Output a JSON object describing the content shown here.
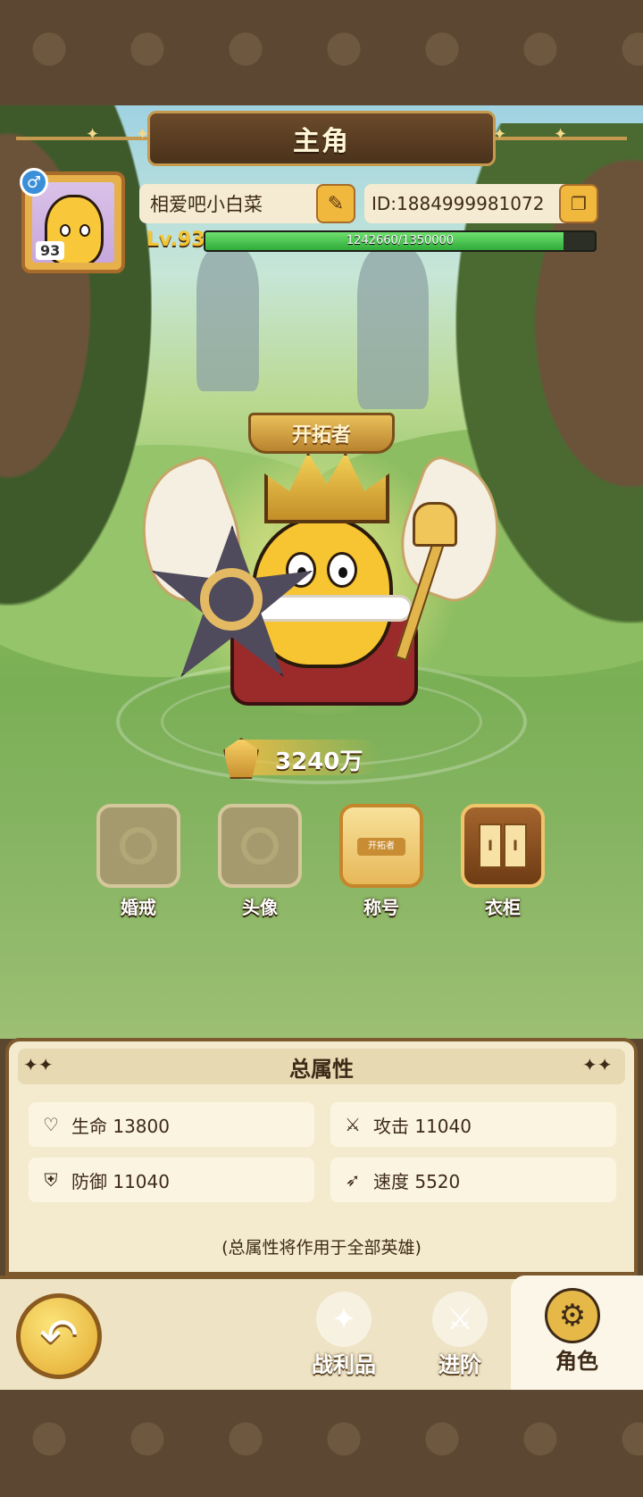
{
  "header": {
    "title": "主角"
  },
  "profile": {
    "gender_symbol": "♂",
    "avatar_level": "93",
    "name": "相爱吧小白菜",
    "id_text": "ID:1884999981072",
    "level_text": "Lv.93",
    "exp_text": "1242660/1350000",
    "exp_fraction": 0.92
  },
  "character": {
    "title_badge": "开拓者",
    "power": "3240万"
  },
  "functions": [
    {
      "label": "婚戒",
      "state": "locked",
      "icon": "ring-icon"
    },
    {
      "label": "头像",
      "state": "locked",
      "icon": "ring-icon"
    },
    {
      "label": "称号",
      "state": "active",
      "icon": "title-plaque-icon",
      "mini_text": "开拓者"
    },
    {
      "label": "衣柜",
      "state": "active",
      "icon": "wardrobe-book-icon",
      "mini_text": "I"
    }
  ],
  "attributes": {
    "title": "总属性",
    "items": [
      {
        "icon": "heart-icon",
        "glyph": "♡",
        "text": "生命 13800"
      },
      {
        "icon": "attack-icon",
        "glyph": "⚔",
        "text": "攻击 11040"
      },
      {
        "icon": "shield-icon",
        "glyph": "⛨",
        "text": "防御 11040"
      },
      {
        "icon": "boot-icon",
        "glyph": "➶",
        "text": "速度 5520"
      }
    ],
    "note": "(总属性将作用于全部英雄)"
  },
  "nav": {
    "back_glyph": "↶",
    "tabs": [
      {
        "label": "战利品",
        "glyph": "✦"
      },
      {
        "label": "进阶",
        "glyph": "⚔"
      },
      {
        "label": "角色",
        "glyph": "⚙"
      }
    ]
  },
  "colors": {
    "accent_gold": "#f0b93e",
    "exp_green": "#2fab3a",
    "frame_brown": "#7c5a2d"
  }
}
